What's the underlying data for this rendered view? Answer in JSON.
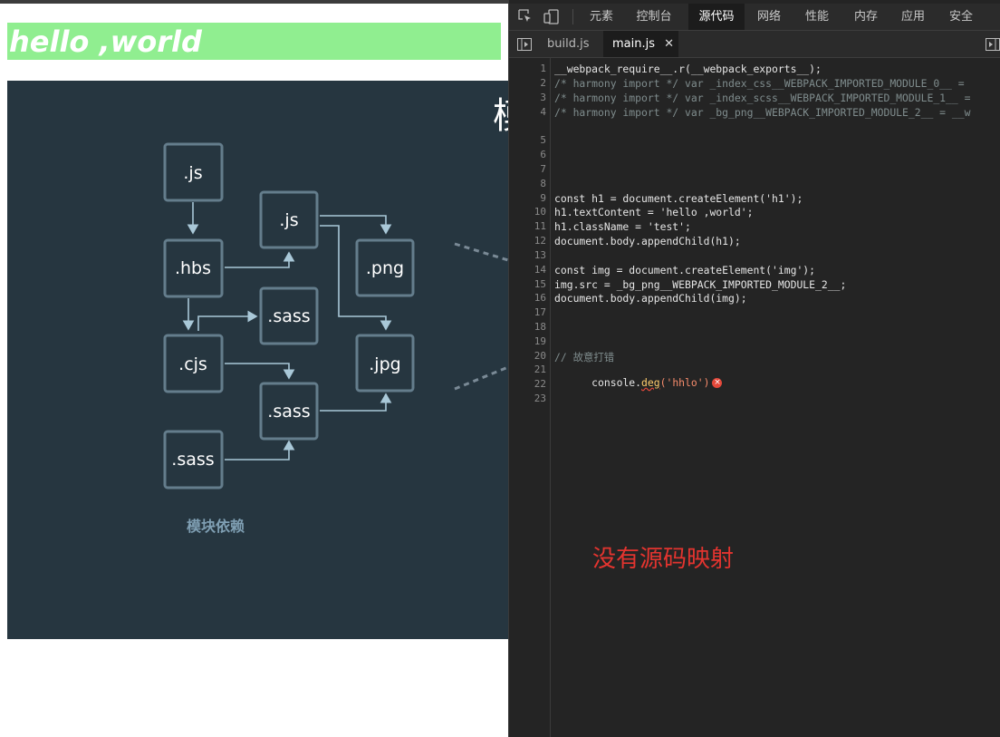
{
  "page": {
    "heading": "hello ,world"
  },
  "diagram": {
    "caption": "模块依赖",
    "title_char": "模",
    "nodes": [
      ".js",
      ".js",
      ".hbs",
      ".png",
      ".sass",
      ".cjs",
      ".jpg",
      ".sass",
      ".sass"
    ]
  },
  "devtools": {
    "toolbar_icons": [
      "inspect-icon",
      "device-toggle-icon"
    ],
    "tabs": [
      "元素",
      "控制台",
      "源代码",
      "网络",
      "性能",
      "内存",
      "应用",
      "安全"
    ],
    "active_tab": "源代码",
    "file_tabs": [
      "build.js",
      "main.js"
    ],
    "active_file": "main.js",
    "line_numbers": [
      "1",
      "2",
      "3",
      "4",
      "5",
      "6",
      "7",
      "8",
      "9",
      "10",
      "11",
      "12",
      "13",
      "14",
      "15",
      "16",
      "17",
      "18",
      "19",
      "20",
      "21",
      "22",
      "23"
    ],
    "code": {
      "l1": "__webpack_require__.r(__webpack_exports__);",
      "l2": "/* harmony import */ var _index_css__WEBPACK_IMPORTED_MODULE_0__ = ",
      "l3": "/* harmony import */ var _index_scss__WEBPACK_IMPORTED_MODULE_1__ = ",
      "l4": "/* harmony import */ var _bg_png__WEBPACK_IMPORTED_MODULE_2__ = __w",
      "l10": "const h1 = document.createElement('h1');",
      "l11": "h1.textContent = 'hello ,world';",
      "l12": "h1.className = 'test';",
      "l13": "document.body.appendChild(h1);",
      "l15": "const img = document.createElement('img');",
      "l16": "img.src = _bg_png__WEBPACK_IMPORTED_MODULE_2__;",
      "l17": "document.body.appendChild(img);",
      "l21": "// 故意打错",
      "l22a": "console.",
      "l22b": "deg",
      "l22c": "('hhlo')"
    },
    "error_marker": "×",
    "annotation": "没有源码映射"
  }
}
